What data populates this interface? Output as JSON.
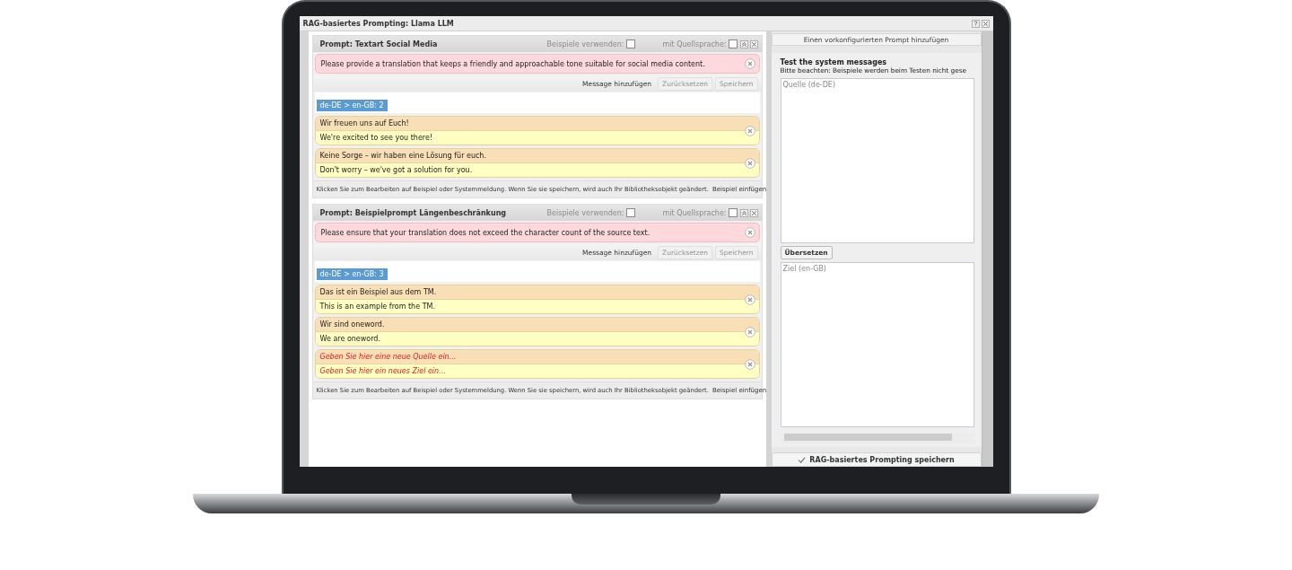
{
  "window": {
    "title": "RAG-basiertes Prompting: Llama LLM"
  },
  "prompts": [
    {
      "title": "Prompt: Textart Social Media",
      "use_examples_label": "Beispiele verwenden:",
      "use_examples": false,
      "with_source_label": "mit Quellsprache:",
      "with_source": false,
      "system_message": "Please provide a translation that keeps a friendly and approachable tone suitable for social media content.",
      "toolbar": {
        "add": "Message hinzufügen",
        "reset": "Zurücksetzen",
        "reset_disabled": true,
        "save": "Speichern",
        "save_disabled": true
      },
      "language_tag": "de-DE > en-GB: 2",
      "examples": [
        {
          "kind": "example",
          "source": "Wir freuen uns auf Euch!",
          "target": "We're excited to see you there!"
        },
        {
          "kind": "example",
          "source": "Keine Sorge – wir haben eine Lösung für euch.",
          "target": "Don't worry – we've got a solution for you."
        }
      ],
      "hint": "Klicken Sie zum Bearbeiten auf Beispiel oder Systemmeldung. Wenn Sie sie speichern, wird auch Ihr Bibliotheksobjekt geändert.",
      "insert": "Beispiel einfügen"
    },
    {
      "title": "Prompt: Beispielprompt Längenbeschränkung",
      "use_examples_label": "Beispiele verwenden:",
      "use_examples": false,
      "with_source_label": "mit Quellsprache:",
      "with_source": false,
      "system_message": "Please ensure that your translation does not exceed the character count of the source text.",
      "toolbar": {
        "add": "Message hinzufügen",
        "reset": "Zurücksetzen",
        "reset_disabled": true,
        "save": "Speichern",
        "save_disabled": true
      },
      "language_tag": "de-DE > en-GB: 3",
      "examples": [
        {
          "kind": "example",
          "source": "Das ist ein Beispiel aus dem TM.",
          "target": "This is an example from the TM."
        },
        {
          "kind": "example",
          "source": "Wir sind oneword.",
          "target": "We are oneword."
        },
        {
          "kind": "placeholder",
          "source": "Geben Sie hier eine neue Quelle ein...",
          "target": "Geben Sie hier ein neues Ziel ein..."
        }
      ],
      "hint": "Klicken Sie zum Bearbeiten auf Beispiel oder Systemmeldung. Wenn Sie sie speichern, wird auch Ihr Bibliotheksobjekt geändert.",
      "insert": "Beispiel einfügen"
    }
  ],
  "sidebar": {
    "add_prompt": "Einen vorkonfigurierten Prompt hinzufügen",
    "test_title": "Test the system messages",
    "test_note": "Bitte beachten: Beispiele werden beim Testen nicht gese",
    "source": {
      "placeholder": "Quelle (de-DE)"
    },
    "translate": "Übersetzen",
    "target": {
      "placeholder": "Ziel (en-GB)"
    },
    "save": "RAG-basiertes Prompting speichern"
  }
}
